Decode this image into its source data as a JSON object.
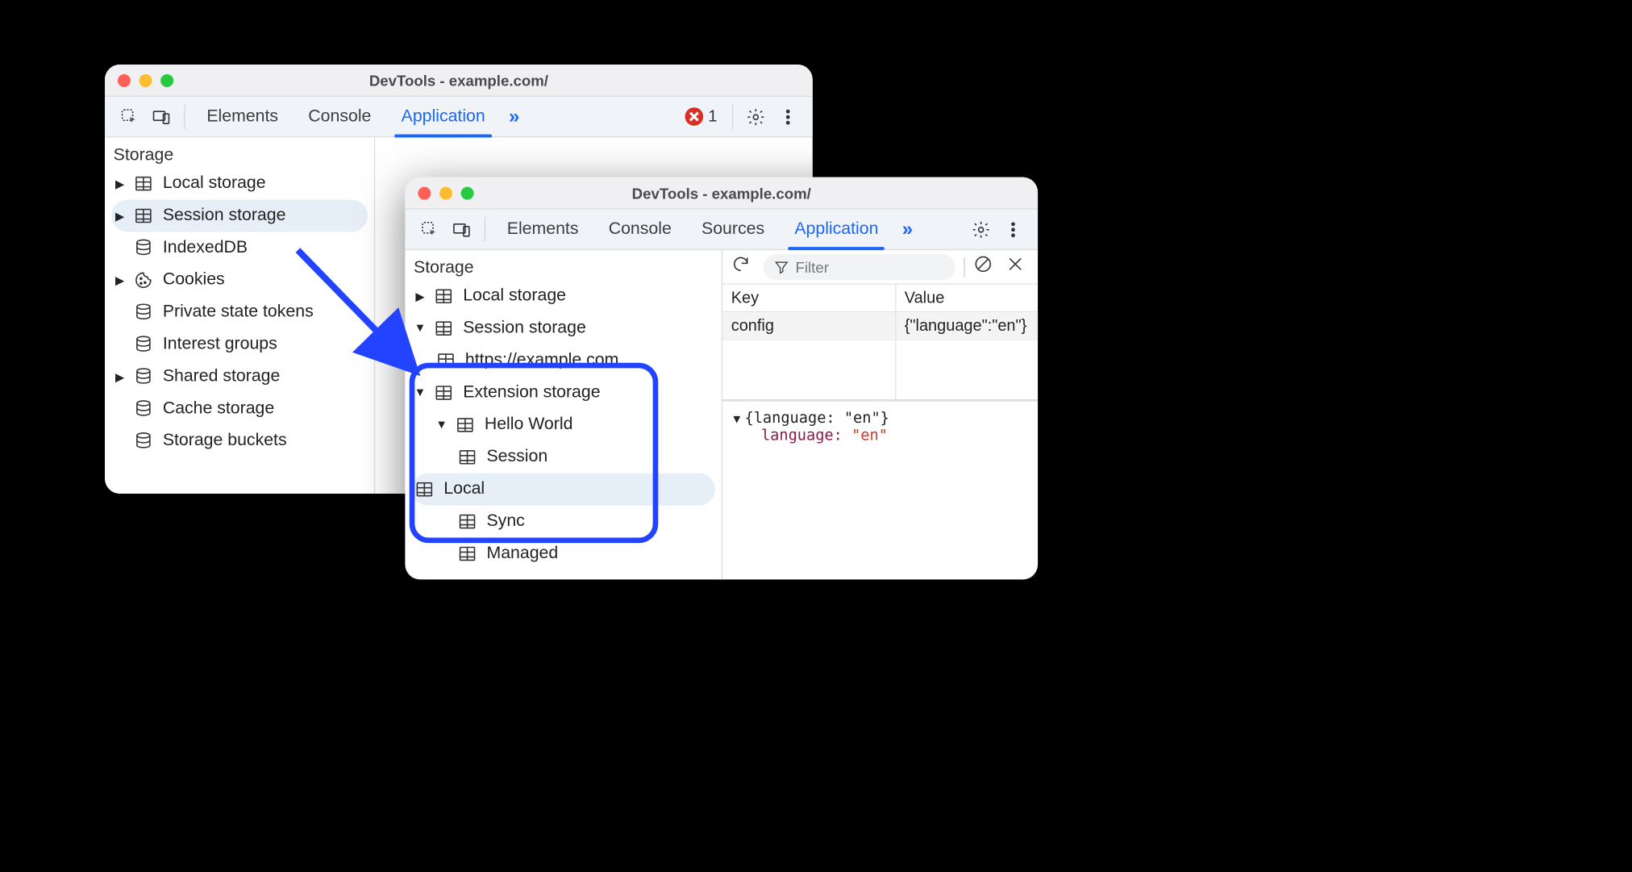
{
  "windowA": {
    "title": "DevTools - example.com/",
    "tabs": {
      "elements": "Elements",
      "console": "Console",
      "application": "Application"
    },
    "error_count": "1",
    "section": "Storage",
    "tree": {
      "local": "Local storage",
      "session": "Session storage",
      "indexeddb": "IndexedDB",
      "cookies": "Cookies",
      "private_tokens": "Private state tokens",
      "interest_groups": "Interest groups",
      "shared": "Shared storage",
      "cache": "Cache storage",
      "buckets": "Storage buckets"
    }
  },
  "windowB": {
    "title": "DevTools - example.com/",
    "tabs": {
      "elements": "Elements",
      "console": "Console",
      "sources": "Sources",
      "application": "Application"
    },
    "section": "Storage",
    "tree": {
      "local": "Local storage",
      "session": "Session storage",
      "session_origin": "https://example.com",
      "extension": "Extension storage",
      "ext_app": "Hello World",
      "ext_session": "Session",
      "ext_local": "Local",
      "ext_sync": "Sync",
      "ext_managed": "Managed"
    },
    "filter_placeholder": "Filter",
    "table": {
      "head_key": "Key",
      "head_val": "Value",
      "row_key": "config",
      "row_val": "{\"language\":\"en\"}"
    },
    "detail": {
      "obj": "{language: \"en\"}",
      "prop_key": "language:",
      "prop_val": "\"en\""
    }
  }
}
